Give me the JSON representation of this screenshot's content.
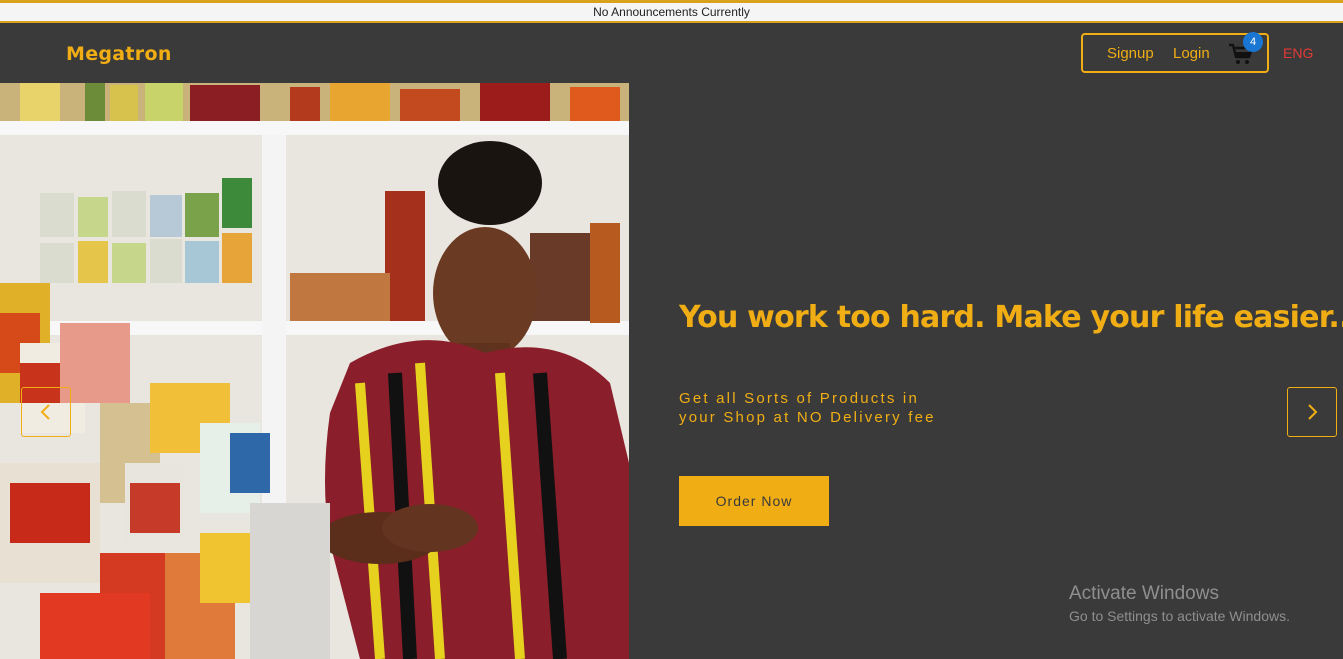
{
  "announcement": "No Announcements Currently",
  "brand": {
    "logo": "Megatron",
    "accent": "#f0ae14",
    "background": "#3a3a3a"
  },
  "nav": {
    "signup": "Signup",
    "login": "Login",
    "cart_count": "4",
    "cart_icon": "shopping-cart-icon",
    "language": "ENG"
  },
  "hero": {
    "headline": "You work too hard. Make your life easier...",
    "subtext_line1": "Get all Sorts of Products in",
    "subtext_line2": "your Shop at NO Delivery fee",
    "cta": "Order Now",
    "prev_icon": "chevron-left-icon",
    "next_icon": "chevron-right-icon"
  },
  "watermark": {
    "title": "Activate Windows",
    "subtitle": "Go to Settings to activate Windows."
  }
}
